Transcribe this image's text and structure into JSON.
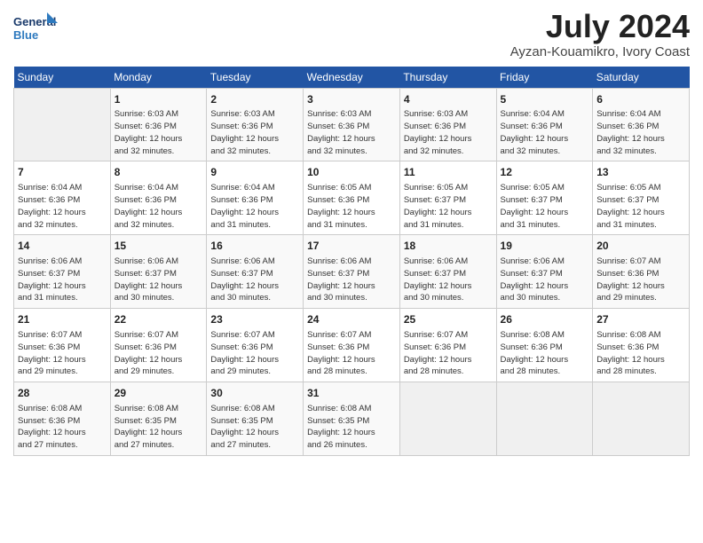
{
  "logo": {
    "line1": "General",
    "line2": "Blue"
  },
  "title": "July 2024",
  "location": "Ayzan-Kouamikro, Ivory Coast",
  "days_of_week": [
    "Sunday",
    "Monday",
    "Tuesday",
    "Wednesday",
    "Thursday",
    "Friday",
    "Saturday"
  ],
  "weeks": [
    [
      {
        "day": "",
        "info": ""
      },
      {
        "day": "1",
        "info": "Sunrise: 6:03 AM\nSunset: 6:36 PM\nDaylight: 12 hours\nand 32 minutes."
      },
      {
        "day": "2",
        "info": "Sunrise: 6:03 AM\nSunset: 6:36 PM\nDaylight: 12 hours\nand 32 minutes."
      },
      {
        "day": "3",
        "info": "Sunrise: 6:03 AM\nSunset: 6:36 PM\nDaylight: 12 hours\nand 32 minutes."
      },
      {
        "day": "4",
        "info": "Sunrise: 6:03 AM\nSunset: 6:36 PM\nDaylight: 12 hours\nand 32 minutes."
      },
      {
        "day": "5",
        "info": "Sunrise: 6:04 AM\nSunset: 6:36 PM\nDaylight: 12 hours\nand 32 minutes."
      },
      {
        "day": "6",
        "info": "Sunrise: 6:04 AM\nSunset: 6:36 PM\nDaylight: 12 hours\nand 32 minutes."
      }
    ],
    [
      {
        "day": "7",
        "info": "Sunrise: 6:04 AM\nSunset: 6:36 PM\nDaylight: 12 hours\nand 32 minutes."
      },
      {
        "day": "8",
        "info": "Sunrise: 6:04 AM\nSunset: 6:36 PM\nDaylight: 12 hours\nand 32 minutes."
      },
      {
        "day": "9",
        "info": "Sunrise: 6:04 AM\nSunset: 6:36 PM\nDaylight: 12 hours\nand 31 minutes."
      },
      {
        "day": "10",
        "info": "Sunrise: 6:05 AM\nSunset: 6:36 PM\nDaylight: 12 hours\nand 31 minutes."
      },
      {
        "day": "11",
        "info": "Sunrise: 6:05 AM\nSunset: 6:37 PM\nDaylight: 12 hours\nand 31 minutes."
      },
      {
        "day": "12",
        "info": "Sunrise: 6:05 AM\nSunset: 6:37 PM\nDaylight: 12 hours\nand 31 minutes."
      },
      {
        "day": "13",
        "info": "Sunrise: 6:05 AM\nSunset: 6:37 PM\nDaylight: 12 hours\nand 31 minutes."
      }
    ],
    [
      {
        "day": "14",
        "info": "Sunrise: 6:06 AM\nSunset: 6:37 PM\nDaylight: 12 hours\nand 31 minutes."
      },
      {
        "day": "15",
        "info": "Sunrise: 6:06 AM\nSunset: 6:37 PM\nDaylight: 12 hours\nand 30 minutes."
      },
      {
        "day": "16",
        "info": "Sunrise: 6:06 AM\nSunset: 6:37 PM\nDaylight: 12 hours\nand 30 minutes."
      },
      {
        "day": "17",
        "info": "Sunrise: 6:06 AM\nSunset: 6:37 PM\nDaylight: 12 hours\nand 30 minutes."
      },
      {
        "day": "18",
        "info": "Sunrise: 6:06 AM\nSunset: 6:37 PM\nDaylight: 12 hours\nand 30 minutes."
      },
      {
        "day": "19",
        "info": "Sunrise: 6:06 AM\nSunset: 6:37 PM\nDaylight: 12 hours\nand 30 minutes."
      },
      {
        "day": "20",
        "info": "Sunrise: 6:07 AM\nSunset: 6:36 PM\nDaylight: 12 hours\nand 29 minutes."
      }
    ],
    [
      {
        "day": "21",
        "info": "Sunrise: 6:07 AM\nSunset: 6:36 PM\nDaylight: 12 hours\nand 29 minutes."
      },
      {
        "day": "22",
        "info": "Sunrise: 6:07 AM\nSunset: 6:36 PM\nDaylight: 12 hours\nand 29 minutes."
      },
      {
        "day": "23",
        "info": "Sunrise: 6:07 AM\nSunset: 6:36 PM\nDaylight: 12 hours\nand 29 minutes."
      },
      {
        "day": "24",
        "info": "Sunrise: 6:07 AM\nSunset: 6:36 PM\nDaylight: 12 hours\nand 28 minutes."
      },
      {
        "day": "25",
        "info": "Sunrise: 6:07 AM\nSunset: 6:36 PM\nDaylight: 12 hours\nand 28 minutes."
      },
      {
        "day": "26",
        "info": "Sunrise: 6:08 AM\nSunset: 6:36 PM\nDaylight: 12 hours\nand 28 minutes."
      },
      {
        "day": "27",
        "info": "Sunrise: 6:08 AM\nSunset: 6:36 PM\nDaylight: 12 hours\nand 28 minutes."
      }
    ],
    [
      {
        "day": "28",
        "info": "Sunrise: 6:08 AM\nSunset: 6:36 PM\nDaylight: 12 hours\nand 27 minutes."
      },
      {
        "day": "29",
        "info": "Sunrise: 6:08 AM\nSunset: 6:35 PM\nDaylight: 12 hours\nand 27 minutes."
      },
      {
        "day": "30",
        "info": "Sunrise: 6:08 AM\nSunset: 6:35 PM\nDaylight: 12 hours\nand 27 minutes."
      },
      {
        "day": "31",
        "info": "Sunrise: 6:08 AM\nSunset: 6:35 PM\nDaylight: 12 hours\nand 26 minutes."
      },
      {
        "day": "",
        "info": ""
      },
      {
        "day": "",
        "info": ""
      },
      {
        "day": "",
        "info": ""
      }
    ]
  ]
}
